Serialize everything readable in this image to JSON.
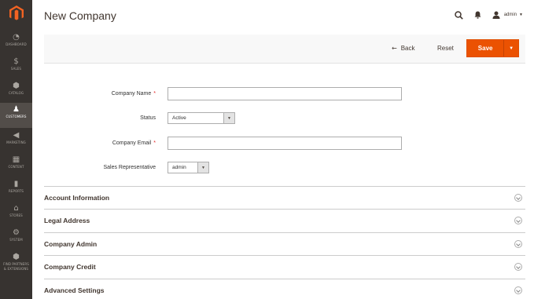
{
  "sidebar": {
    "items": [
      {
        "label": "DASHBOARD",
        "icon": "dashboard-icon",
        "glyph": "◔"
      },
      {
        "label": "SALES",
        "icon": "dollar-icon",
        "glyph": "$"
      },
      {
        "label": "CATALOG",
        "icon": "cube-icon",
        "glyph": "⬢"
      },
      {
        "label": "CUSTOMERS",
        "icon": "person-icon",
        "glyph": "♟"
      },
      {
        "label": "MARKETING",
        "icon": "megaphone-icon",
        "glyph": "◀"
      },
      {
        "label": "CONTENT",
        "icon": "layout-icon",
        "glyph": "▦"
      },
      {
        "label": "REPORTS",
        "icon": "bar-chart-icon",
        "glyph": "▮"
      },
      {
        "label": "STORES",
        "icon": "storefront-icon",
        "glyph": "⌂"
      },
      {
        "label": "SYSTEM",
        "icon": "gear-icon",
        "glyph": "⚙"
      },
      {
        "label": "FIND PARTNERS & EXTENSIONS",
        "label_line1": "FIND PARTNERS",
        "label_line2": "& EXTENSIONS",
        "icon": "extensions-icon",
        "glyph": "⬢"
      }
    ],
    "active": "CUSTOMERS"
  },
  "header": {
    "title": "New Company",
    "user": "admin"
  },
  "toolbar": {
    "back_label": "Back",
    "reset_label": "Reset",
    "save_label": "Save"
  },
  "form": {
    "company_name_label": "Company Name",
    "company_name_value": "",
    "status_label": "Status",
    "status_value": "Active",
    "company_email_label": "Company Email",
    "company_email_value": "",
    "sales_rep_label": "Sales Representative",
    "sales_rep_value": "admin"
  },
  "sections": [
    "Account Information",
    "Legal Address",
    "Company Admin",
    "Company Credit",
    "Advanced Settings"
  ],
  "colors": {
    "sidebar_bg": "#373330",
    "accent": "#eb5202",
    "required": "#e22626"
  }
}
